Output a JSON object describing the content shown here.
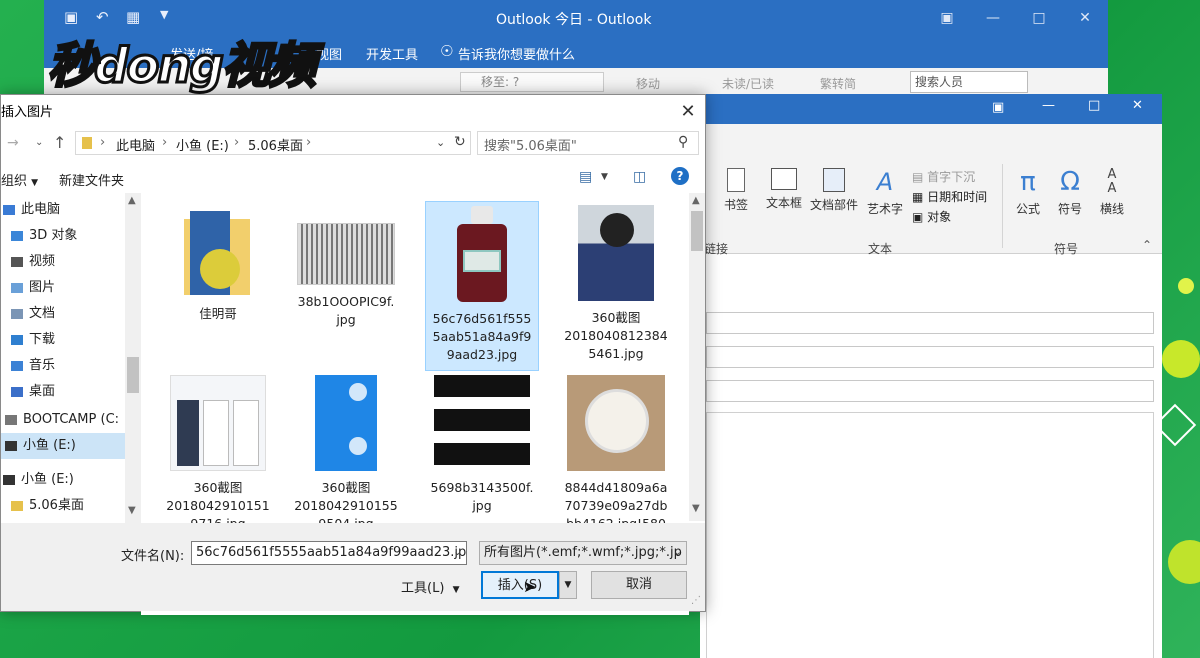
{
  "watermark": "秒dong视频",
  "back_window": {
    "title": "Outlook 今日  -  Outlook",
    "tabs": [
      "发送/接",
      "视图",
      "开发工具"
    ],
    "tell_me": "告诉我你想要做什么",
    "toolbar": {
      "move_to": "移至: ?",
      "move": "移动",
      "unread_read": "未读/已读",
      "traditional": "繁转简",
      "search_people": "搜索人员"
    }
  },
  "message_window": {
    "ribbon_buttons": [
      "书签",
      "文本框",
      "文档部件",
      "艺术字",
      "公式",
      "符号",
      "横线"
    ],
    "small_buttons": [
      "首字下沉",
      "日期和时间",
      "对象"
    ],
    "groups": [
      "链接",
      "文本",
      "符号"
    ]
  },
  "dialog": {
    "title": "插入图片",
    "breadcrumb": [
      "此电脑",
      "小鱼 (E:)",
      "5.06桌面"
    ],
    "search_placeholder": "搜索\"5.06桌面\"",
    "organize": "组织",
    "new_folder": "新建文件夹",
    "tree": [
      {
        "label": "此电脑",
        "icon": "pc-icon"
      },
      {
        "label": "3D 对象",
        "icon": "folder-3d-icon"
      },
      {
        "label": "视频",
        "icon": "video-folder-icon"
      },
      {
        "label": "图片",
        "icon": "pictures-folder-icon"
      },
      {
        "label": "文档",
        "icon": "documents-folder-icon"
      },
      {
        "label": "下载",
        "icon": "downloads-folder-icon"
      },
      {
        "label": "音乐",
        "icon": "music-folder-icon"
      },
      {
        "label": "桌面",
        "icon": "desktop-folder-icon"
      },
      {
        "label": "BOOTCAMP (C:",
        "icon": "drive-icon"
      },
      {
        "label": "小鱼 (E:)",
        "icon": "drive-icon"
      },
      {
        "label": "小鱼 (E:)",
        "icon": "drive-icon"
      },
      {
        "label": "5.06桌面",
        "icon": "folder-icon"
      }
    ],
    "files": [
      {
        "name": "佳明哥",
        "kind": "folder"
      },
      {
        "name": "38b1OOOPIC9f.jpg",
        "kind": "world-map"
      },
      {
        "name": "56c76d561f5555aab51a84a9f99aad23.jpg",
        "kind": "bottle",
        "selected": true
      },
      {
        "name": "360截图20180408123845461.jpg",
        "kind": "poster"
      },
      {
        "name": "360截图201804291015​19716.jpg",
        "kind": "screens"
      },
      {
        "name": "360截图201804291015​59504.jpg",
        "kind": "blue-app"
      },
      {
        "name": "5698b3143500f.jpg",
        "kind": "silhouette"
      },
      {
        "name": "8844d41809a6a70739e09a27dbbb4162.jpg!580",
        "kind": "food"
      }
    ],
    "file_labels": [
      [
        "佳明哥"
      ],
      [
        "38b1OOOPIC9f.",
        "jpg"
      ],
      [
        "56c76d561f555",
        "5aab51a84a9f9",
        "9aad23.jpg"
      ],
      [
        "360截图",
        "2018040812384",
        "5461.jpg"
      ],
      [
        "360截图",
        "2018042910151",
        "9716.jpg"
      ],
      [
        "360截图",
        "2018042910155",
        "9504.jpg"
      ],
      [
        "5698b3143500f.",
        "jpg"
      ],
      [
        "8844d41809a6a",
        "70739e09a27db",
        "bb4162.jpg!580"
      ]
    ],
    "filename_label": "文件名(N):",
    "filename_value": "56c76d561f5555aab51a84a9f99aad23.jpg",
    "filetype_value": "所有图片(*.emf;*.wmf;*.jpg;*.jp",
    "tools": "工具(L)",
    "insert": "插入(S)",
    "cancel": "取消"
  },
  "colors": {
    "outlook_blue": "#2b6fc2",
    "selection": "#cce8ff",
    "primary_border": "#0078d7",
    "desktop_green": "#1d9d4a"
  }
}
